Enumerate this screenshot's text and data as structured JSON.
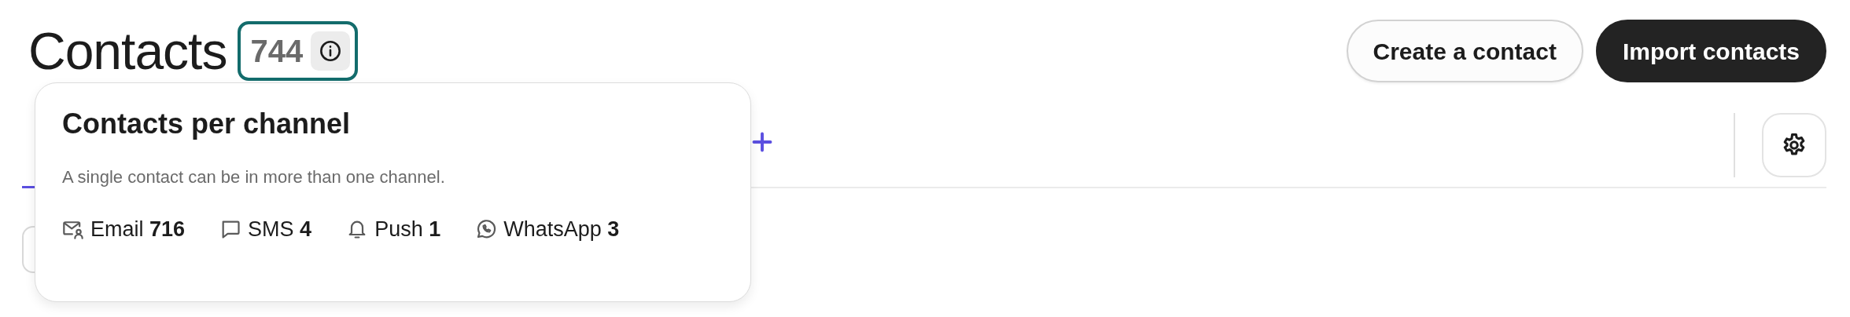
{
  "header": {
    "title": "Contacts",
    "count": "744"
  },
  "buttons": [
    {
      "label": "Create a contact",
      "kind": "secondary"
    },
    {
      "label": "Import contacts",
      "kind": "primary"
    }
  ],
  "popover": {
    "title": "Contacts per channel",
    "description": "A single contact can be in more than one channel.",
    "channels": [
      {
        "kind": "email",
        "text": "Email **716**"
      },
      {
        "kind": "sms",
        "text": "SMS **4**"
      },
      {
        "kind": "push",
        "text": "Push **1**"
      },
      {
        "kind": "whatsapp",
        "text": "WhatsApp **3**"
      }
    ]
  }
}
